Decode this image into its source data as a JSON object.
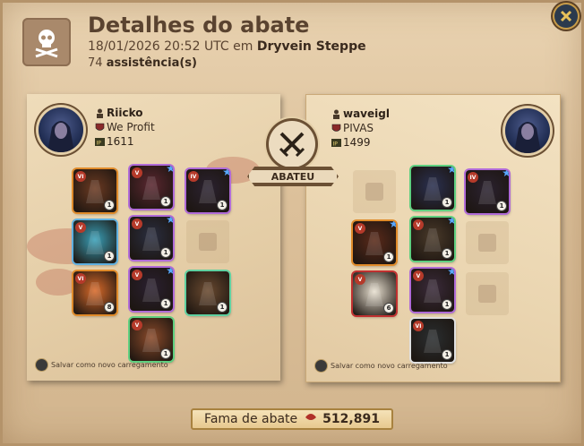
{
  "header": {
    "title": "Detalhes do abate",
    "timestamp": "18/01/2026 20:52 UTC em",
    "location": "Dryvein Steppe",
    "assist_count": "74",
    "assist_label": "assistência(s)"
  },
  "center": {
    "banner_label": "ABATEU"
  },
  "killer": {
    "name": "Riicko",
    "guild": "We Profit",
    "ip": "1611",
    "save_label": "Salvar como novo carregamento"
  },
  "victim": {
    "name": "waveigl",
    "guild": "PIVAS",
    "ip": "1499",
    "save_label": "Salvar como novo carregamento"
  },
  "killer_items": [
    {
      "slot": "bag",
      "tier": "VI",
      "qty": "1",
      "color": "#6b3a22",
      "border": "#e08b2a",
      "star": false
    },
    {
      "slot": "head",
      "tier": "V",
      "qty": "1",
      "color": "#5a2730",
      "border": "#b06bd8",
      "star": true
    },
    {
      "slot": "cape",
      "tier": "IV",
      "qty": "1",
      "color": "#2b2230",
      "border": "#b06bd8",
      "star": true
    },
    {
      "slot": "mainhand",
      "tier": "V",
      "qty": "1",
      "color": "#3aa0b8",
      "border": "#5fb0e0",
      "star": false
    },
    {
      "slot": "armor",
      "tier": "V",
      "qty": "1",
      "color": "#2a2e40",
      "border": "#b06bd8",
      "star": true
    },
    {
      "slot": "offhand",
      "tier": "",
      "qty": "",
      "color": "",
      "border": "",
      "star": false
    },
    {
      "slot": "potion",
      "tier": "VI",
      "qty": "8",
      "color": "#d86a2a",
      "border": "#e08b2a",
      "star": false
    },
    {
      "slot": "shoes",
      "tier": "V",
      "qty": "1",
      "color": "#2a2030",
      "border": "#b06bd8",
      "star": true
    },
    {
      "slot": "food",
      "tier": "",
      "qty": "1",
      "color": "#6a4a30",
      "border": "#5fd0a0",
      "star": false
    },
    {
      "slot": "mount",
      "tier": "V",
      "qty": "1",
      "color": "#8a4a2a",
      "border": "#5fd080",
      "star": false
    }
  ],
  "victim_items": [
    {
      "slot": "bag",
      "tier": "",
      "qty": "",
      "color": "",
      "border": "",
      "star": false
    },
    {
      "slot": "head",
      "tier": "",
      "qty": "1",
      "color": "#2a3050",
      "border": "#5fd080",
      "star": true
    },
    {
      "slot": "cape",
      "tier": "IV",
      "qty": "1",
      "color": "#2b2230",
      "border": "#b06bd8",
      "star": true
    },
    {
      "slot": "mainhand",
      "tier": "V",
      "qty": "1",
      "color": "#5a2a1a",
      "border": "#e08b2a",
      "star": true
    },
    {
      "slot": "armor",
      "tier": "V",
      "qty": "1",
      "color": "#4a3a2a",
      "border": "#5fd080",
      "star": true
    },
    {
      "slot": "offhand",
      "tier": "",
      "qty": "",
      "color": "",
      "border": "",
      "star": false
    },
    {
      "slot": "potion",
      "tier": "V",
      "qty": "6",
      "color": "#e8e0d0",
      "border": "#c03030",
      "star": false
    },
    {
      "slot": "shoes",
      "tier": "V",
      "qty": "1",
      "color": "#3a2a3a",
      "border": "#b06bd8",
      "star": true
    },
    {
      "slot": "food",
      "tier": "",
      "qty": "",
      "color": "",
      "border": "",
      "star": false
    },
    {
      "slot": "mount",
      "tier": "VI",
      "qty": "1",
      "color": "#2a2e30",
      "border": "#e0e0e0",
      "star": false
    }
  ],
  "footer": {
    "fame_label": "Fama de abate",
    "fame_value": "512,891"
  },
  "colors": {
    "accent_gold": "#c79c4a",
    "text_dark": "#3a2a1d",
    "close_bg": "#2b3a4d"
  }
}
